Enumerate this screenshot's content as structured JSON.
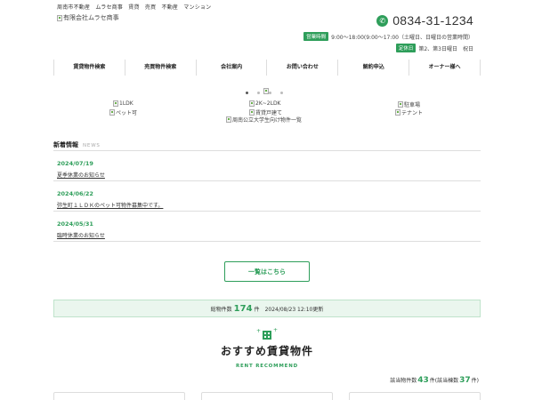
{
  "header": {
    "tagline": "周南市不動産　ムラセ商事　賃貸　売買　不動産　マンション",
    "logo_alt": "有限会社ムラセ商事",
    "phone": "0834-31-1234",
    "hours_badge": "営業時間",
    "hours_text": "9:00～18:00(9:00～17:00（土曜日、日曜日の営業時間）",
    "holiday_badge": "定休日",
    "holiday_text": "第2、第3日曜日　祝日"
  },
  "nav": {
    "items": [
      {
        "label": "賃貸物件検索"
      },
      {
        "label": "売買物件検索"
      },
      {
        "label": "会社案内"
      },
      {
        "label": "お問い合わせ"
      },
      {
        "label": "解約申込"
      },
      {
        "label": "オーナー様へ"
      }
    ]
  },
  "slider": {
    "dot_count": 4,
    "active_index": 0
  },
  "banners": {
    "b1": "1LDK",
    "b2": "ペット可",
    "b3": "2K~2LDK",
    "b4": "賃貸戸建て",
    "b5": "周南公立大学生向け物件一覧",
    "b6": "駐車場",
    "b7": "テナント"
  },
  "news": {
    "title": "新着情報",
    "title_en": "NEWS",
    "items": [
      {
        "date": "2024/07/19",
        "text": "夏季休業のお知らせ"
      },
      {
        "date": "2024/06/22",
        "text": "弥生町１ＬＤＫのペット可物件募集中です。"
      },
      {
        "date": "2024/05/31",
        "text": "臨時休業のお知らせ"
      }
    ],
    "more_label": "一覧はこちら"
  },
  "totals": {
    "prefix": "総物件数",
    "count": "174",
    "suffix": "件",
    "updated": "2024/08/23 12:10更新"
  },
  "recommend": {
    "title": "おすすめ賃貸物件",
    "subtitle": "RENT RECOMMEND",
    "count_prefix": "該当物件数",
    "count": "43",
    "count_mid": "件(該当棟数",
    "buildings": "37",
    "count_suffix": "件)"
  },
  "colors": {
    "accent": "#2e9e5a"
  }
}
